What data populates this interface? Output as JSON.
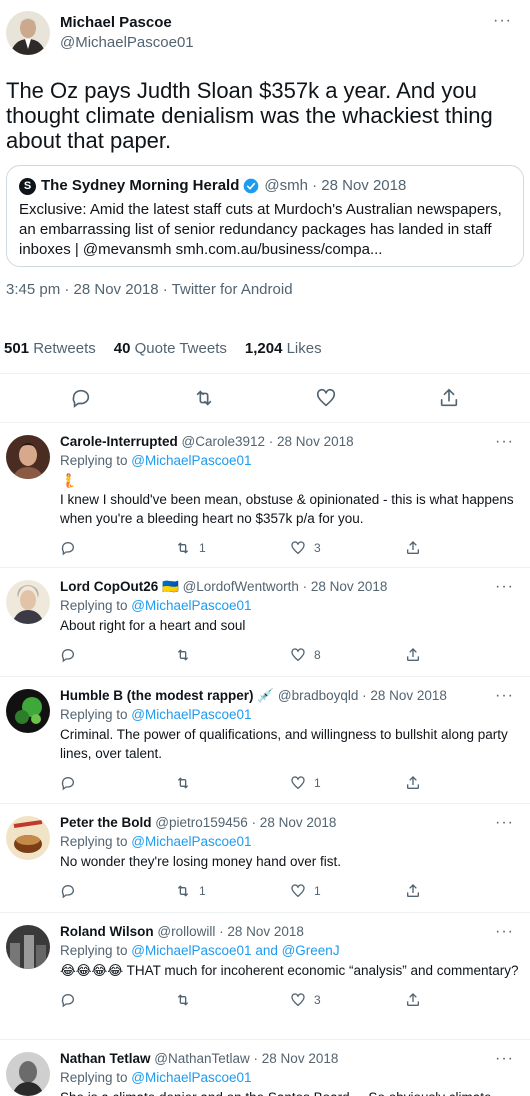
{
  "main": {
    "name": "Michael Pascoe",
    "handle": "@MichaelPascoe01",
    "text": "The Oz pays Judth Sloan $357k a year. And you thought climate denialism was the whackiest thing about that paper.",
    "quote": {
      "logo_letter": "S",
      "name": "The Sydney Morning Herald",
      "meta": "@smh · 28 Nov 2018",
      "text": "Exclusive: Amid the latest staff cuts at Murdoch's Australian newspapers, an embarrassing list of senior redundancy packages has landed in staff inboxes | @mevansmh smh.com.au/business/compa..."
    },
    "timestamp": "3:45 pm · 28 Nov 2018 · Twitter for Android",
    "retweets_count": "501",
    "retweets_label": "Retweets",
    "quotes_count": "40",
    "quotes_label": "Quote Tweets",
    "likes_count": "1,204",
    "likes_label": "Likes",
    "more": "···"
  },
  "replies": [
    {
      "name": "Carole-Interrupted",
      "handle": "@Carole3912",
      "date": " · 28 Nov 2018",
      "replying_prefix": "Replying to ",
      "replying_to": "@MichaelPascoe01",
      "text": "🧜\nI knew I should've been mean, obstuse & opinionated - this is what happens when you're a bleeding heart no $357k p/a for you.",
      "retweets": "1",
      "likes": "3"
    },
    {
      "name": "Lord CopOut26 🇺🇦",
      "handle": "@LordofWentworth",
      "date": " · 28 Nov 2018",
      "replying_prefix": "Replying to ",
      "replying_to": "@MichaelPascoe01",
      "text": "About right for a heart and soul",
      "retweets": "",
      "likes": "8"
    },
    {
      "name": "Humble B (the modest rapper) 💉",
      "handle": "@bradboyqld",
      "date": " · 28 Nov 2018",
      "replying_prefix": "Replying to ",
      "replying_to": "@MichaelPascoe01",
      "text": "Criminal. The power of qualifications, and willingness to bullshit along party lines, over talent.",
      "retweets": "",
      "likes": "1"
    },
    {
      "name": "Peter the Bold",
      "handle": "@pietro159456",
      "date": " · 28 Nov 2018",
      "replying_prefix": "Replying to ",
      "replying_to": "@MichaelPascoe01",
      "text": "No wonder they're losing money hand over fist.",
      "retweets": "1",
      "likes": "1"
    },
    {
      "name": "Roland Wilson",
      "handle": "@rollowill",
      "date": " · 28 Nov 2018",
      "replying_prefix": "Replying to ",
      "replying_to": "@MichaelPascoe01 and @GreenJ",
      "text": "😂😂😂😂 THAT much for incoherent economic “analysis” and commentary?",
      "retweets": "",
      "likes": "3"
    },
    {
      "name": "Nathan Tetlaw",
      "handle": "@NathanTetlaw",
      "date": " · 28 Nov 2018",
      "replying_prefix": "Replying to ",
      "replying_to": "@MichaelPascoe01",
      "text": "She is a climate denier and on the Santos Board.... So obviously climate scientists are in some conspiracy for the money",
      "retweets": "",
      "likes": ""
    }
  ],
  "colors": {
    "text": "#0f1419",
    "muted": "#536471",
    "link": "#1d9bf0",
    "border": "#cfd9de",
    "verified": "#1d9bf0"
  }
}
